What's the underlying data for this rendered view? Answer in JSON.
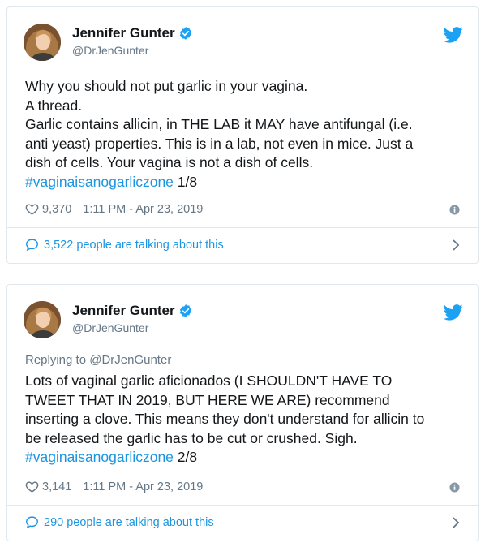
{
  "tweets": [
    {
      "author_name": "Jennifer Gunter",
      "author_handle": "@DrJenGunter",
      "replying_to": "",
      "lines": [
        "Why you should not put garlic in your vagina.",
        "A thread.",
        "Garlic contains allicin, in THE LAB it MAY have antifungal (i.e.",
        "anti yeast) properties. This is in a lab, not even in mice. Just a",
        "dish of cells. Your vagina is not a dish of cells."
      ],
      "hashtag": "#vaginaisanogarliczone",
      "thread_position": "1/8",
      "likes": "9,370",
      "timestamp": "1:11 PM - Apr 23, 2019",
      "talking": "3,522 people are talking about this"
    },
    {
      "author_name": "Jennifer Gunter",
      "author_handle": "@DrJenGunter",
      "replying_to": "Replying to @DrJenGunter",
      "lines": [
        "Lots of vaginal garlic aficionados (I SHOULDN'T HAVE TO",
        "TWEET THAT IN 2019, BUT HERE WE ARE) recommend",
        "inserting a clove. This means they don't understand for allicin to",
        "be released the garlic has to be cut or crushed. Sigh."
      ],
      "hashtag": "#vaginaisanogarliczone",
      "thread_position": "2/8",
      "likes": "3,141",
      "timestamp": "1:11 PM - Apr 23, 2019",
      "talking": "290 people are talking about this"
    }
  ],
  "icons": {
    "verified": "verified-badge-icon",
    "twitter": "twitter-bird-icon",
    "like": "heart-icon",
    "info": "info-icon",
    "talk": "speech-bubble-icon",
    "chevron": "chevron-right-icon"
  },
  "colors": {
    "link": "#1b95e0",
    "muted": "#657786",
    "text": "#14171a",
    "border": "#e1e8ed"
  }
}
